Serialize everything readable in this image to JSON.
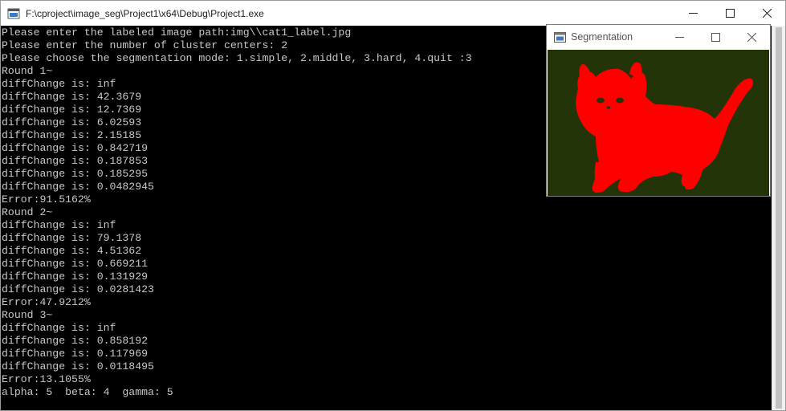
{
  "console_window": {
    "title": "F:\\cproject\\image_seg\\Project1\\x64\\Debug\\Project1.exe",
    "lines": [
      "Please enter the labeled image path:img\\\\cat1_label.jpg",
      "Please enter the number of cluster centers: 2",
      "Please choose the segmentation mode: 1.simple, 2.middle, 3.hard, 4.quit :3",
      "Round 1~",
      "diffChange is: inf",
      "diffChange is: 42.3679",
      "diffChange is: 12.7369",
      "diffChange is: 6.02593",
      "diffChange is: 2.15185",
      "diffChange is: 0.842719",
      "diffChange is: 0.187853",
      "diffChange is: 0.185295",
      "diffChange is: 0.0482945",
      "Error:91.5162%",
      "Round 2~",
      "diffChange is: inf",
      "diffChange is: 79.1378",
      "diffChange is: 4.51362",
      "diffChange is: 0.669211",
      "diffChange is: 0.131929",
      "diffChange is: 0.0281423",
      "Error:47.9212%",
      "Round 3~",
      "diffChange is: inf",
      "diffChange is: 0.858192",
      "diffChange is: 0.117969",
      "diffChange is: 0.0118495",
      "Error:13.1055%",
      "alpha: 5  beta: 4  gamma: 5"
    ]
  },
  "segmentation_window": {
    "title": "Segmentation",
    "background_color": "#233508",
    "foreground_color": "#ff0000"
  },
  "icons": {
    "console_app": "console-app-icon",
    "segmentation_app": "image-window-icon",
    "minimize": "minimize-icon",
    "maximize": "maximize-icon",
    "close": "close-icon"
  }
}
